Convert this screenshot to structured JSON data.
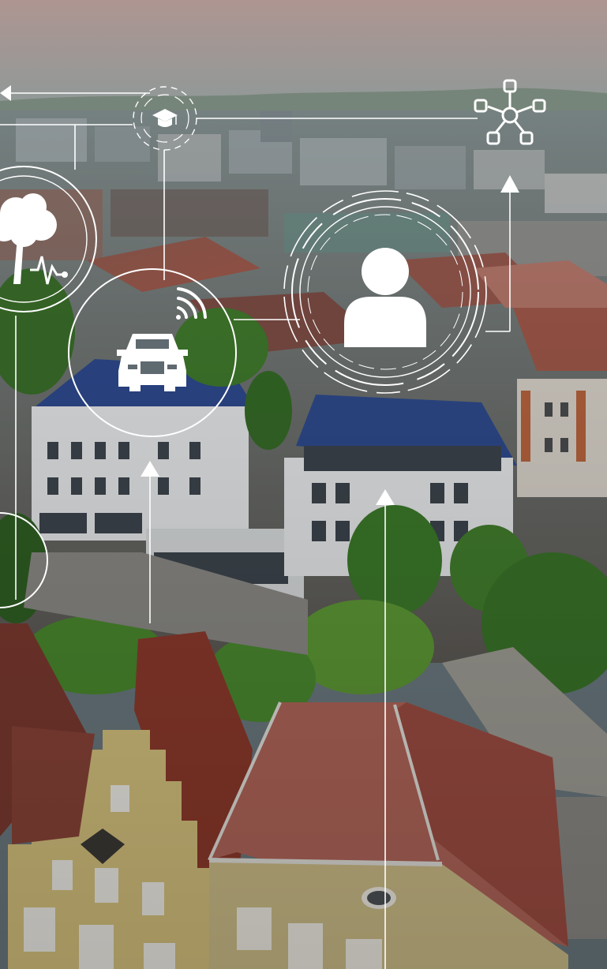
{
  "scene": {
    "colors": {
      "sky_top": "#b39a97",
      "sky_bottom": "#9ea7a4",
      "hills": "#7d8f7e",
      "roofs_red": "#9a4a3c",
      "blue_roof": "#2f4b8e",
      "building_white": "#e9ecef",
      "tree_green": "#3f7a2c",
      "yellow_gable": "#d9c57e",
      "overlay_white": "#ffffff"
    },
    "icons": [
      "graduation-cap-icon",
      "network-hub-icon",
      "tree-icon",
      "heartbeat-icon",
      "car-icon",
      "wifi-icon",
      "person-icon"
    ]
  }
}
